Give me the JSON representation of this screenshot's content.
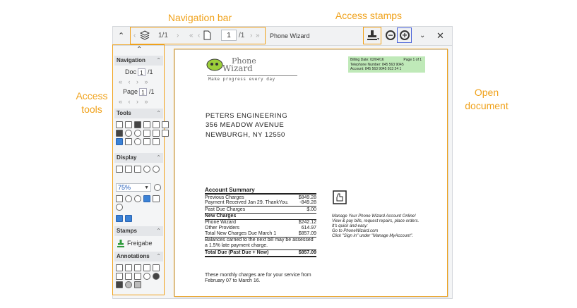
{
  "callouts": {
    "navigation_bar": "Navigation bar",
    "access_stamps": "Access stamps",
    "access_tools_1": "Access",
    "access_tools_2": "tools",
    "open_document_1": "Open",
    "open_document_2": "document"
  },
  "toolbar": {
    "doc_count": "1/1",
    "page_value": "1",
    "page_total": "/1",
    "document_title": "Phone Wizard"
  },
  "sidebar": {
    "navigation": {
      "title": "Navigation",
      "doc_label": "Doc",
      "doc_value": "1",
      "doc_total": "/1",
      "page_label": "Page",
      "page_value": "1",
      "page_total": "/1"
    },
    "tools": {
      "title": "Tools"
    },
    "display": {
      "title": "Display",
      "zoom": "75%"
    },
    "stamps": {
      "title": "Stamps",
      "item": "Freigabe"
    },
    "annotations": {
      "title": "Annotations"
    }
  },
  "document": {
    "logo_line1": "Phone",
    "logo_line2": "Wizard",
    "slogan": "Make progress every day",
    "billing": {
      "date": "Billing Date: 02/04/16",
      "page": "Page 1 of 1",
      "phone": "Telephone Number: 845 563 9045",
      "account": "Account: 845 563 9045 813 24 1"
    },
    "address": [
      "PETERS ENGINEERING",
      "356 MEADOW AVENUE",
      "NEWBURGH, NY 12550"
    ],
    "summary_title": "Account Summary",
    "rows": [
      {
        "label": "Previous Charges",
        "amount": "$849.28"
      },
      {
        "label": "Payment Received Jan 29. ThankYou.",
        "amount": "-849.28"
      },
      {
        "label": "Past Due Charges",
        "amount": "$.00"
      },
      {
        "label": "New Charges",
        "amount": ""
      },
      {
        "label": "Phone Wizard",
        "amount": "$242.12"
      },
      {
        "label": "Other Providers",
        "amount": "614.97"
      },
      {
        "label": "Total New Charges Due March 1",
        "amount": "$857.09"
      },
      {
        "label": "Balances carried to the next bill may be assessed",
        "amount": ""
      },
      {
        "label": "a 1.5% late payment charge.",
        "amount": ""
      },
      {
        "label": "Total Due (Past Due + New)",
        "amount": "$857.09"
      }
    ],
    "promo": [
      "Manage Your Phone Wizard Account Online!",
      "View & pay bills, request repairs, place orders.",
      "It's quick and easy:",
      "Go to PhoneWizard.com",
      "Click \"Sign in\" under \"Manage MyAccount\"."
    ],
    "footer_1": "These monthly charges are for your service from",
    "footer_2": "February 07 to March 16."
  }
}
